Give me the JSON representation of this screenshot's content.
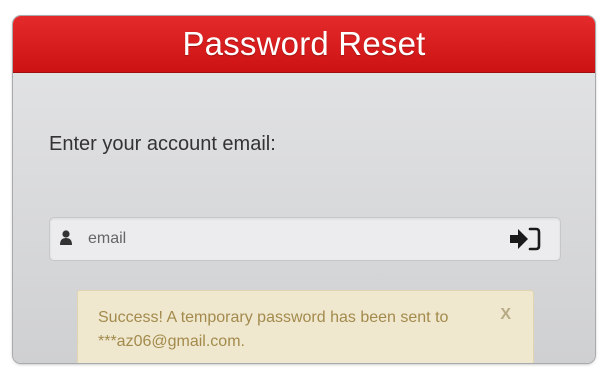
{
  "header": {
    "title": "Password Reset"
  },
  "form": {
    "label": "Enter your account email:",
    "email_placeholder": "email",
    "email_value": "",
    "user_icon": "user-icon",
    "submit_icon": "sign-in-icon"
  },
  "alert": {
    "message": "Success! A temporary password has been sent to ***az06@gmail.com.",
    "close_label": "X"
  },
  "colors": {
    "header_red": "#d81c1c",
    "panel_gray": "#d6d7d9",
    "alert_bg": "#efe8cf",
    "alert_text": "#a38a4c"
  }
}
